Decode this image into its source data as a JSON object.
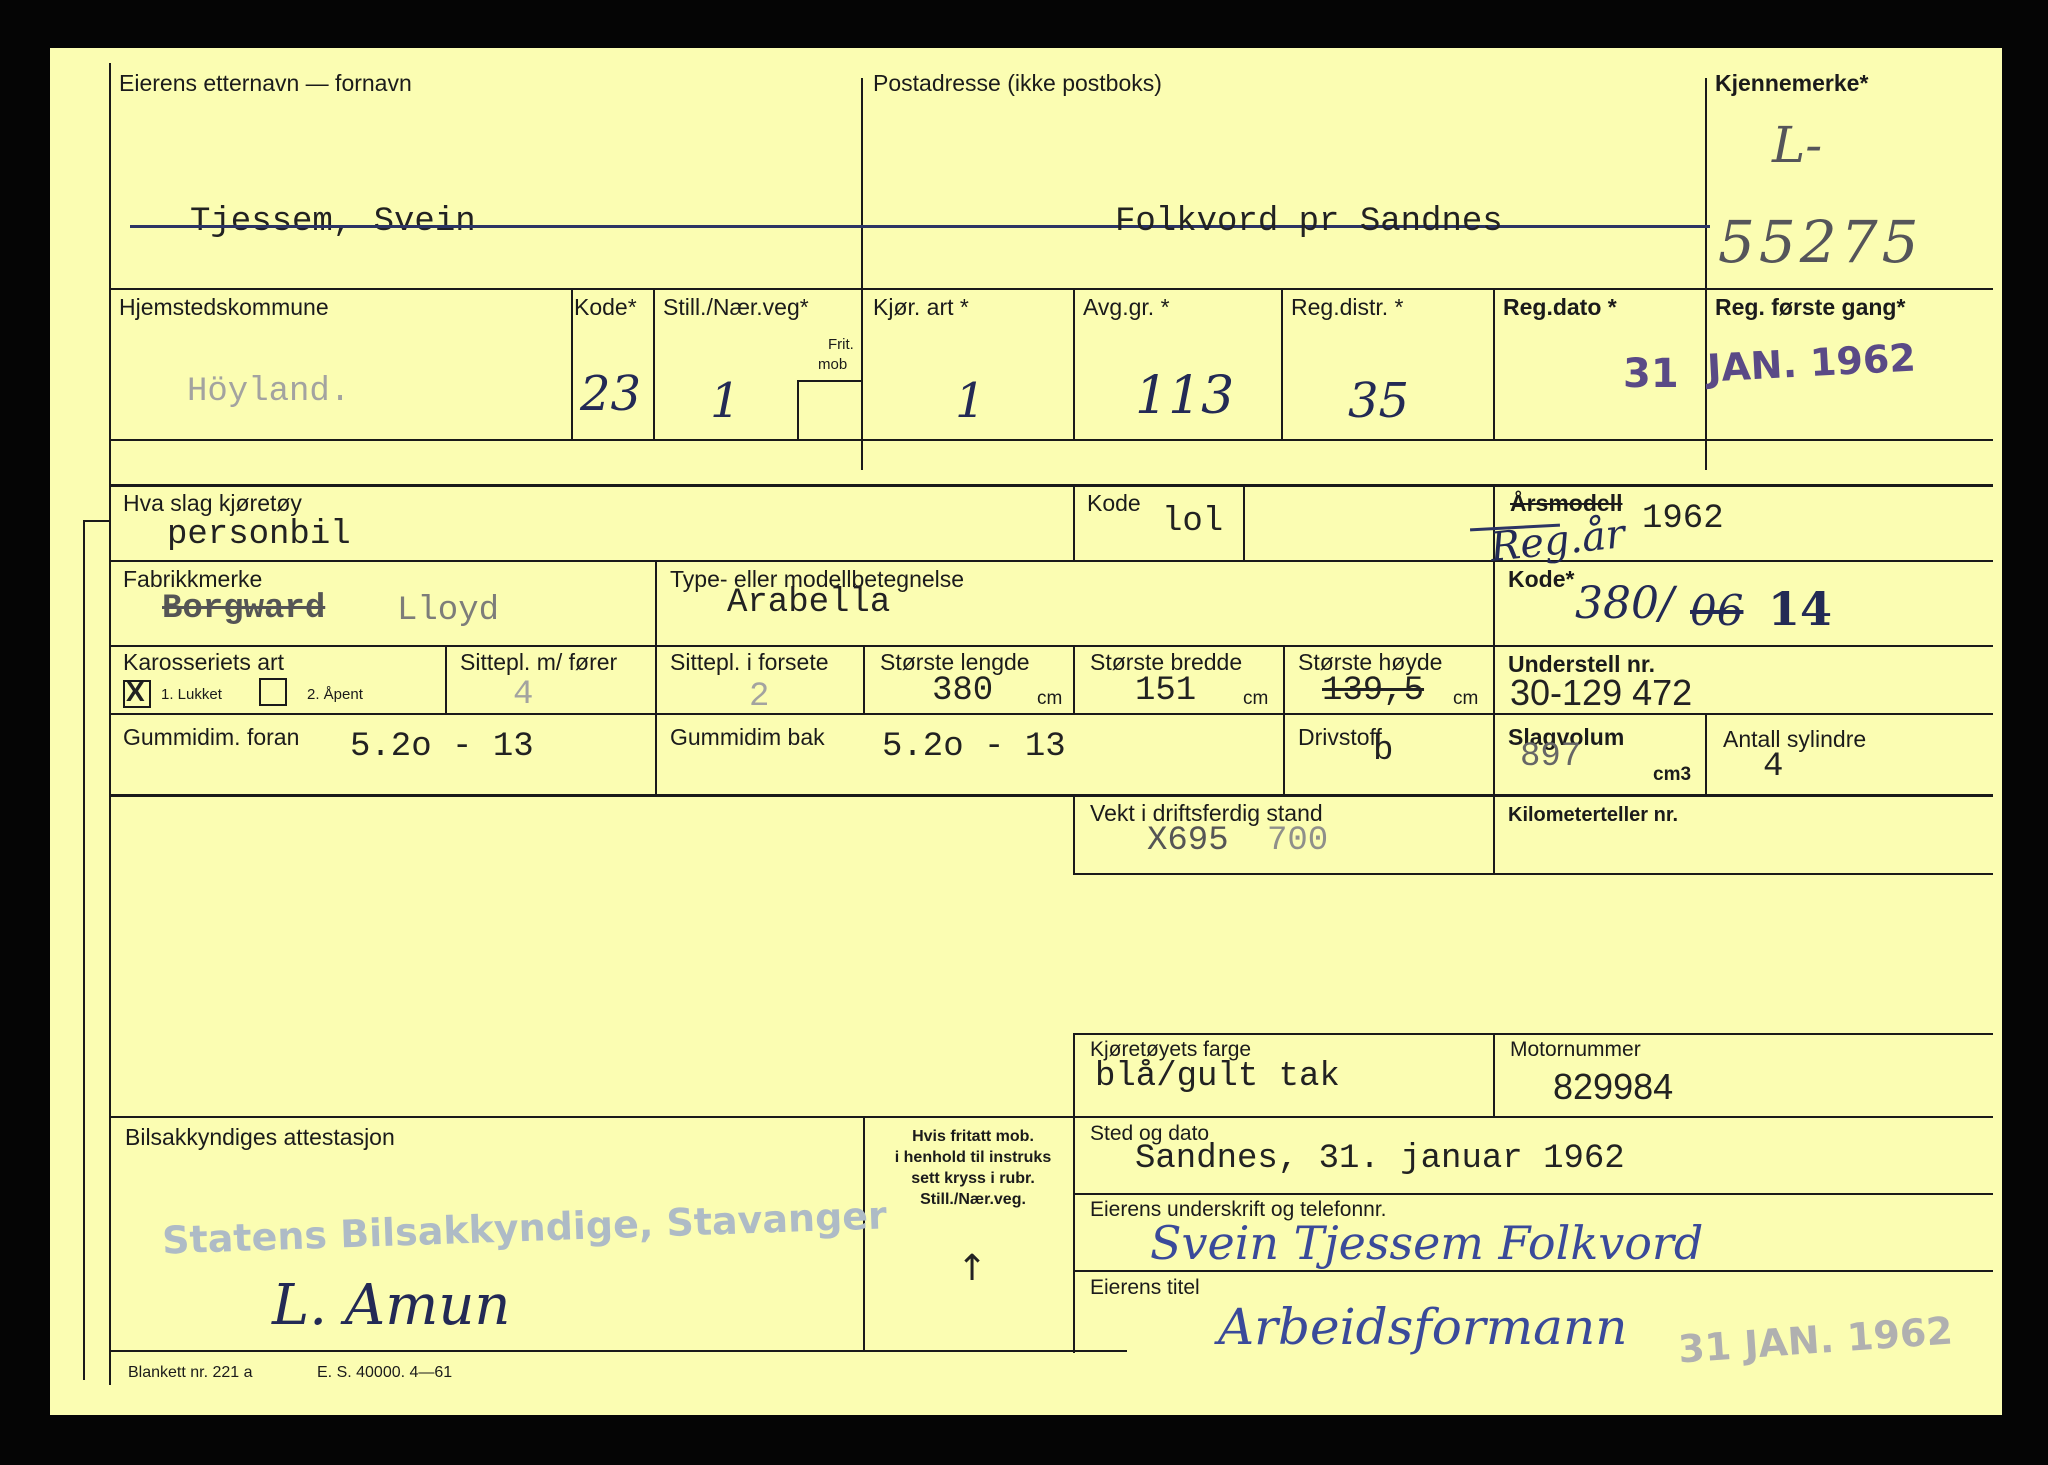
{
  "owner": {
    "name_label": "Eierens etternavn — fornavn",
    "name_value": "Tjessem, Svein",
    "address_label": "Postadresse (ikke postboks)",
    "address_value": "Folkvord pr Sandnes",
    "plate_label": "Kjennemerke*",
    "plate_prefix": "L-",
    "plate_number": "55275"
  },
  "registration": {
    "municipality_label": "Hjemstedskommune",
    "municipality_value": "Höyland.",
    "kode_label": "Kode*",
    "kode_value": "23",
    "still_label": "Still./Nær.veg*",
    "frit_label": "Frit.",
    "mob_label": "mob",
    "still_value": "1",
    "kjor_label": "Kjør. art *",
    "kjor_value": "1",
    "avg_label": "Avg.gr. *",
    "avg_value": "113",
    "regdistr_label": "Reg.distr. *",
    "regdistr_value": "35",
    "regdato_label": "Reg.dato *",
    "regdato_day": "31",
    "first_reg_label": "Reg. første gang*",
    "first_reg_value": "JAN. 1962"
  },
  "vehicle": {
    "type_label": "Hva slag kjøretøy",
    "type_value": "personbil",
    "type_code_label": "Kode",
    "type_code_value": "lol",
    "model_year_label": "Årsmodell",
    "model_year_value": "1962",
    "model_year_note": "Reg.år",
    "make_label": "Fabrikkmerke",
    "make_struck": "Borgward",
    "make_value": "Lloyd",
    "model_label": "Type- eller modellbetegnelse",
    "model_value": "Arabella",
    "model_code_label": "Kode*",
    "model_code_value": "380/",
    "model_code_struck": "06",
    "model_code_new": "14",
    "body_label": "Karosseriets art",
    "body_mark": "X",
    "body_opt1": "1. Lukket",
    "body_opt2": "2. Åpent",
    "seats_driver_label": "Sittepl. m/ fører",
    "seats_driver_value": "4",
    "seats_front_label": "Sittepl. i forsete",
    "seats_front_value": "2",
    "length_label": "Største lengde",
    "length_value": "380",
    "width_label": "Største bredde",
    "width_value": "151",
    "height_label": "Største høyde",
    "height_value": "139,5",
    "unit_cm": "cm",
    "chassis_label": "Understell nr.",
    "chassis_value": "30-129 472",
    "tyre_front_label": "Gummidim. foran",
    "tyre_front_value": "5.2o - 13",
    "tyre_rear_label": "Gummidim bak",
    "tyre_rear_value": "5.2o - 13",
    "fuel_label": "Drivstoff",
    "fuel_value": "b",
    "displacement_label": "Slagvolum",
    "displacement_value": "897",
    "displacement_unit": "cm3",
    "cylinders_label": "Antall sylindre",
    "cylinders_value": "4",
    "weight_label": "Vekt i driftsferdig stand",
    "weight_struck": "X695",
    "weight_value": "700",
    "odometer_label": "Kilometerteller nr.",
    "colour_label": "Kjøretøyets farge",
    "colour_value": "blå/gult tak",
    "engine_label": "Motornummer",
    "engine_value": "829984"
  },
  "attestation": {
    "label": "Bilsakkyndiges attestasjon",
    "stamp": "Statens Bilsakkyndige, Stavanger",
    "signature": "L. Amun",
    "note": [
      "Hvis fritatt mob.",
      "i henhold til instruks",
      "sett kryss i rubr.",
      "Still./Nær.veg."
    ],
    "place_date_label": "Sted og dato",
    "place_date_value": "Sandnes, 31. januar 1962",
    "signature_label": "Eierens underskrift og telefonnr.",
    "owner_signature": "Svein Tjessem Folkvord",
    "title_label": "Eierens titel",
    "owner_title": "Arbeidsformann",
    "date_stamp": "31 JAN. 1962"
  },
  "footer": {
    "form_no": "Blankett nr. 221 a",
    "print_info": "E. S. 40000. 4—61"
  }
}
